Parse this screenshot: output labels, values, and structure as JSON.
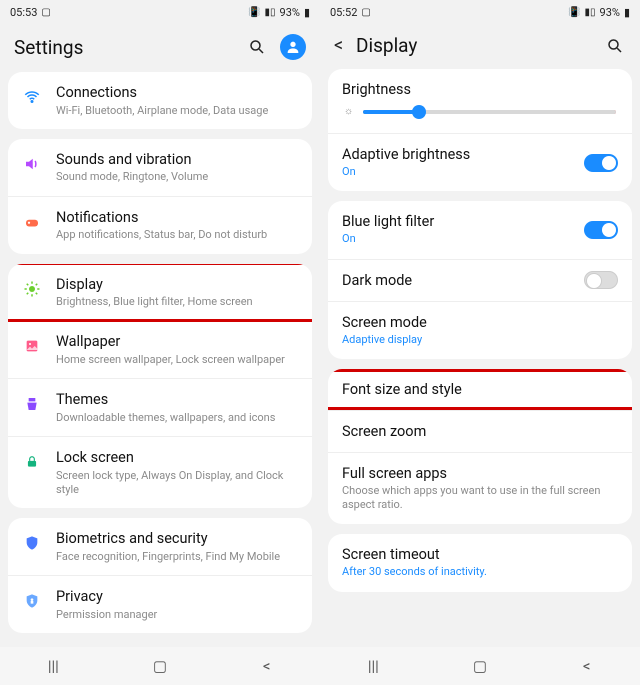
{
  "left": {
    "status": {
      "time": "05:53",
      "battery": "93%"
    },
    "header": {
      "title": "Settings"
    },
    "groups": [
      [
        {
          "icon": "wifi",
          "color": "#1a8cff",
          "title": "Connections",
          "sub": "Wi-Fi, Bluetooth, Airplane mode, Data usage"
        }
      ],
      [
        {
          "icon": "sound",
          "color": "#b64aff",
          "title": "Sounds and vibration",
          "sub": "Sound mode, Ringtone, Volume"
        },
        {
          "icon": "notif",
          "color": "#ff6b4a",
          "title": "Notifications",
          "sub": "App notifications, Status bar, Do not disturb"
        }
      ],
      [
        {
          "icon": "display",
          "color": "#6ccf2f",
          "title": "Display",
          "sub": "Brightness, Blue light filter, Home screen",
          "highlight": true
        },
        {
          "icon": "wallpaper",
          "color": "#ff5c8a",
          "title": "Wallpaper",
          "sub": "Home screen wallpaper, Lock screen wallpaper"
        },
        {
          "icon": "themes",
          "color": "#8a4aff",
          "title": "Themes",
          "sub": "Downloadable themes, wallpapers, and icons"
        },
        {
          "icon": "lock",
          "color": "#14b37e",
          "title": "Lock screen",
          "sub": "Screen lock type, Always On Display, and Clock style"
        }
      ],
      [
        {
          "icon": "shield",
          "color": "#4a7bff",
          "title": "Biometrics and security",
          "sub": "Face recognition, Fingerprints, Find My Mobile"
        },
        {
          "icon": "privacy",
          "color": "#6aa8ff",
          "title": "Privacy",
          "sub": "Permission manager"
        }
      ]
    ]
  },
  "right": {
    "status": {
      "time": "05:52",
      "battery": "93%"
    },
    "header": {
      "title": "Display"
    },
    "brightness_label": "Brightness",
    "groups": [
      [
        {
          "title": "Adaptive brightness",
          "sub": "On",
          "subBlue": true,
          "toggle": "on"
        }
      ],
      [
        {
          "title": "Blue light filter",
          "sub": "On",
          "subBlue": true,
          "toggle": "on"
        },
        {
          "title": "Dark mode",
          "toggle": "off"
        },
        {
          "title": "Screen mode",
          "sub": "Adaptive display",
          "subBlue": true
        }
      ],
      [
        {
          "title": "Font size and style",
          "highlight": true
        },
        {
          "title": "Screen zoom"
        },
        {
          "title": "Full screen apps",
          "sub": "Choose which apps you want to use in the full screen aspect ratio."
        }
      ],
      [
        {
          "title": "Screen timeout",
          "sub": "After 30 seconds of inactivity.",
          "subBlue": true
        }
      ]
    ]
  }
}
